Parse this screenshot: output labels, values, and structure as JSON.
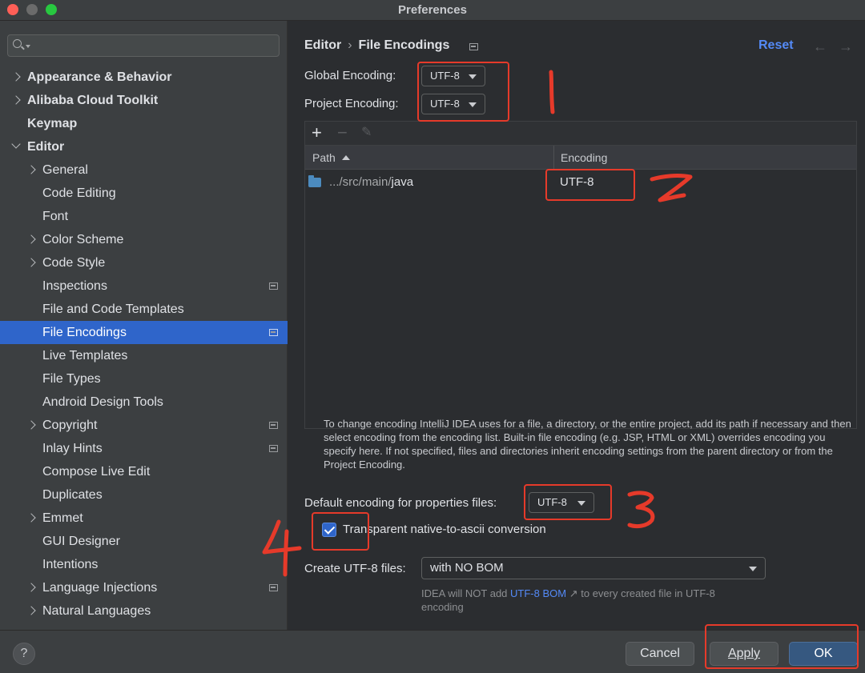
{
  "window": {
    "title": "Preferences"
  },
  "sidebar": {
    "search_placeholder": "",
    "items": [
      {
        "label": "Appearance & Behavior"
      },
      {
        "label": "Alibaba Cloud Toolkit"
      },
      {
        "label": "Keymap"
      },
      {
        "label": "Editor"
      },
      {
        "label": "General"
      },
      {
        "label": "Code Editing"
      },
      {
        "label": "Font"
      },
      {
        "label": "Color Scheme"
      },
      {
        "label": "Code Style"
      },
      {
        "label": "Inspections"
      },
      {
        "label": "File and Code Templates"
      },
      {
        "label": "File Encodings"
      },
      {
        "label": "Live Templates"
      },
      {
        "label": "File Types"
      },
      {
        "label": "Android Design Tools"
      },
      {
        "label": "Copyright"
      },
      {
        "label": "Inlay Hints"
      },
      {
        "label": "Compose Live Edit"
      },
      {
        "label": "Duplicates"
      },
      {
        "label": "Emmet"
      },
      {
        "label": "GUI Designer"
      },
      {
        "label": "Intentions"
      },
      {
        "label": "Language Injections"
      },
      {
        "label": "Natural Languages"
      }
    ]
  },
  "main": {
    "breadcrumb": {
      "parent": "Editor",
      "current": "File Encodings"
    },
    "reset_label": "Reset",
    "global_encoding": {
      "label": "Global Encoding:",
      "value": "UTF-8"
    },
    "project_encoding": {
      "label": "Project Encoding:",
      "value": "UTF-8"
    },
    "table": {
      "columns": [
        "Path",
        "Encoding"
      ],
      "rows": [
        {
          "path_prefix": ".../src/main/",
          "path_last": "java",
          "encoding": "UTF-8"
        }
      ]
    },
    "help_text": "To change encoding IntelliJ IDEA uses for a file, a directory, or the entire project, add its path if necessary and then select encoding from the encoding list. Built-in file encoding (e.g. JSP, HTML or XML) overrides encoding you specify here. If not specified, files and directories inherit encoding settings from the parent directory or from the Project Encoding.",
    "properties_encoding": {
      "label": "Default encoding for properties files:",
      "value": "UTF-8"
    },
    "native_to_ascii": {
      "label": "Transparent native-to-ascii conversion",
      "checked": true
    },
    "create_utf8": {
      "label": "Create UTF-8 files:",
      "value": "with NO BOM"
    },
    "bom_note": {
      "before": "IDEA will NOT add ",
      "link": "UTF-8 BOM",
      "arrow": "↗",
      "after": " to every created file in UTF-8 encoding"
    }
  },
  "footer": {
    "help": "?",
    "cancel": "Cancel",
    "apply": "Apply",
    "ok": "OK"
  },
  "annotations": [
    "1",
    "2",
    "3",
    "4"
  ],
  "colors": {
    "accent": "#2f65ca",
    "link": "#548af7",
    "annotation": "#e63a2a"
  }
}
